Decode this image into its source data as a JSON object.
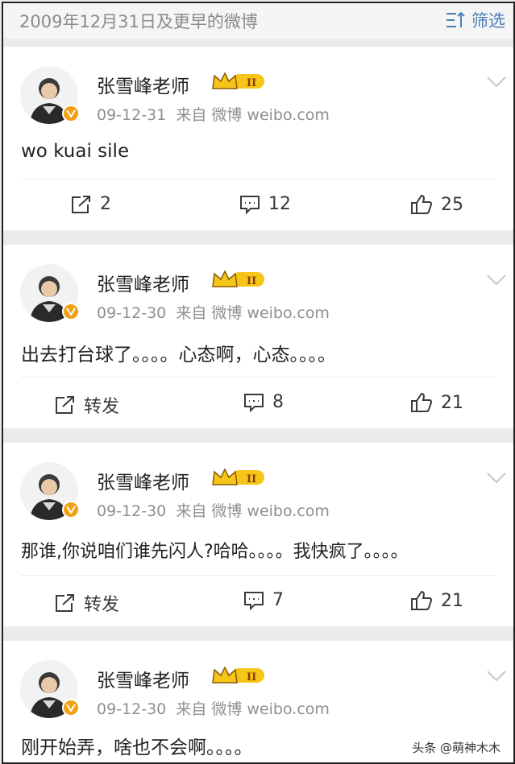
{
  "header": {
    "date_range": "2009年12月31日及更早的微博",
    "filter_label": "筛选"
  },
  "posts": [
    {
      "author": "张雪峰老师",
      "date": "09-12-31",
      "source": "来自 微博 weibo.com",
      "text": "wo kuai sile",
      "repost": "2",
      "comments": "12",
      "likes": "25"
    },
    {
      "author": "张雪峰老师",
      "date": "09-12-30",
      "source": "来自 微博 weibo.com",
      "text": "出去打台球了。。。。心态啊，心态。。。。",
      "repost": "转发",
      "comments": "8",
      "likes": "21"
    },
    {
      "author": "张雪峰老师",
      "date": "09-12-30",
      "source": "来自 微博 weibo.com",
      "text": "那谁,你说咱们谁先闪人?哈哈。。。。我快疯了。。。。",
      "repost": "转发",
      "comments": "7",
      "likes": "21"
    },
    {
      "author": "张雪峰老师",
      "date": "09-12-30",
      "source": "来自 微博 weibo.com",
      "text": "刚开始弄，啥也不会啊。。。。"
    }
  ],
  "watermark": "头条 @萌神木木",
  "colors": {
    "link": "#4a7fb8",
    "badge": "#f2a012",
    "meta": "#8f8f8f"
  }
}
